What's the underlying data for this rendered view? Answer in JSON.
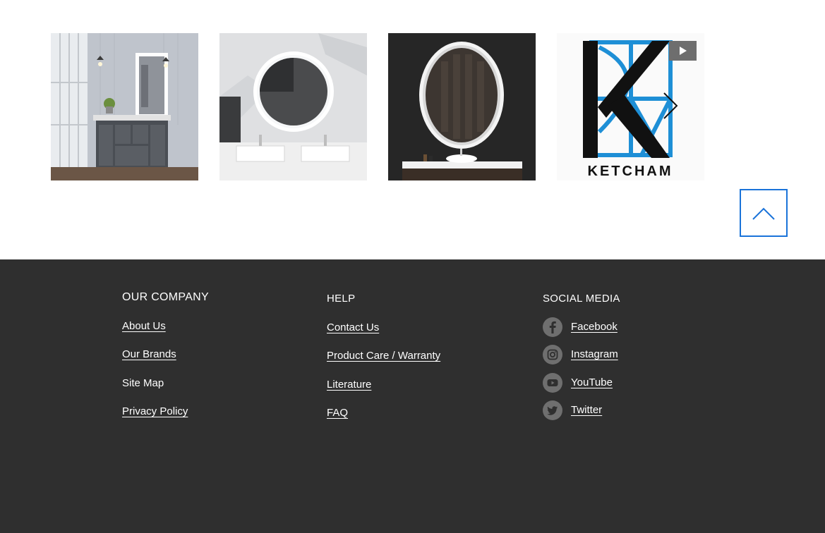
{
  "gallery": {
    "images": [
      {
        "alt": "Bathroom vanity with lighted mirror"
      },
      {
        "alt": "Round backlit mirror over double sinks"
      },
      {
        "alt": "Oval backlit mirror over vessel sink"
      },
      {
        "alt": "Ketcham logo video"
      }
    ],
    "logo_text": "KETCHAM",
    "icons": {
      "next": "chevron-right-icon",
      "play": "play-icon",
      "back_to_top": "chevron-up-icon"
    },
    "accent_color": "#1a73d9"
  },
  "footer": {
    "background": "#2f2f2f",
    "company": {
      "heading": "OUR COMPANY",
      "links": [
        "About Us",
        "Our Brands",
        "Site Map",
        "Privacy Policy"
      ]
    },
    "help": {
      "heading": "HELP",
      "links": [
        "Contact Us",
        "Product Care / Warranty",
        "Literature",
        "FAQ"
      ]
    },
    "social": {
      "heading": "SOCIAL MEDIA",
      "links": [
        {
          "label": "Facebook",
          "icon": "facebook-icon"
        },
        {
          "label": "Instagram",
          "icon": "instagram-icon"
        },
        {
          "label": "YouTube",
          "icon": "youtube-icon"
        },
        {
          "label": "Twitter",
          "icon": "twitter-icon"
        }
      ]
    }
  }
}
